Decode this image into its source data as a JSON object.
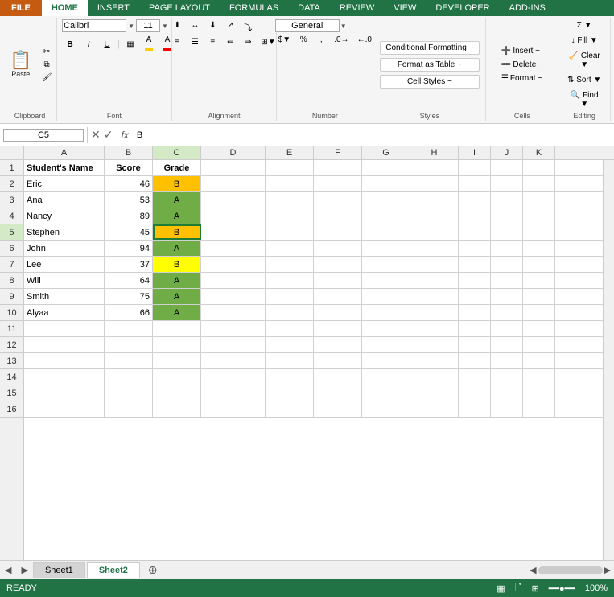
{
  "ribbon": {
    "file_label": "FILE",
    "tabs": [
      "HOME",
      "INSERT",
      "PAGE LAYOUT",
      "FORMULAS",
      "DATA",
      "REVIEW",
      "VIEW",
      "DEVELOPER",
      "ADD-INS"
    ],
    "active_tab": "HOME",
    "groups": {
      "clipboard": {
        "label": "Clipboard",
        "paste": "Paste"
      },
      "font": {
        "label": "Font",
        "font_name": "Calibri",
        "font_size": "11",
        "bold": "B",
        "italic": "I",
        "underline": "U",
        "increase_font": "A",
        "decrease_font": "A"
      },
      "alignment": {
        "label": "Alignment"
      },
      "number": {
        "label": "Number",
        "format": "General"
      },
      "styles": {
        "label": "Styles",
        "conditional_formatting": "Conditional Formatting ~",
        "format_as_table": "Format as Table ~",
        "cell_styles": "Cell Styles ~"
      },
      "cells": {
        "label": "Cells",
        "insert": "Insert ~",
        "delete": "Delete ~",
        "format": "Format ~"
      },
      "editing": {
        "label": "Editing"
      }
    }
  },
  "formula_bar": {
    "name_box": "C5",
    "formula_value": "B"
  },
  "spreadsheet": {
    "columns": [
      {
        "letter": "A",
        "width": 100
      },
      {
        "letter": "B",
        "width": 60
      },
      {
        "letter": "C",
        "width": 60
      },
      {
        "letter": "D",
        "width": 80
      },
      {
        "letter": "E",
        "width": 60
      },
      {
        "letter": "F",
        "width": 60
      },
      {
        "letter": "G",
        "width": 60
      },
      {
        "letter": "H",
        "width": 60
      },
      {
        "letter": "I",
        "width": 60
      },
      {
        "letter": "J",
        "width": 60
      },
      {
        "letter": "K",
        "width": 60
      }
    ],
    "rows": [
      {
        "num": 1,
        "cells": [
          {
            "val": "Student's Name",
            "bold": true,
            "bg": "",
            "color": "",
            "align": "left"
          },
          {
            "val": "Score",
            "bold": true,
            "bg": "",
            "color": "",
            "align": "center"
          },
          {
            "val": "Grade",
            "bold": true,
            "bg": "",
            "color": "",
            "align": "center"
          },
          {
            "val": "",
            "bg": "",
            "color": "",
            "align": "left"
          }
        ]
      },
      {
        "num": 2,
        "cells": [
          {
            "val": "Eric",
            "bold": false,
            "bg": "",
            "color": "",
            "align": "left"
          },
          {
            "val": "46",
            "bold": false,
            "bg": "",
            "color": "",
            "align": "right"
          },
          {
            "val": "B",
            "bold": false,
            "bg": "#ffc000",
            "color": "#000",
            "align": "center"
          },
          {
            "val": "",
            "bg": "",
            "color": "",
            "align": "left"
          }
        ]
      },
      {
        "num": 3,
        "cells": [
          {
            "val": "Ana",
            "bold": false,
            "bg": "",
            "color": "",
            "align": "left"
          },
          {
            "val": "53",
            "bold": false,
            "bg": "",
            "color": "",
            "align": "right"
          },
          {
            "val": "A",
            "bold": false,
            "bg": "#70ad47",
            "color": "#000",
            "align": "center"
          },
          {
            "val": "",
            "bg": "",
            "color": "",
            "align": "left"
          }
        ]
      },
      {
        "num": 4,
        "cells": [
          {
            "val": "Nancy",
            "bold": false,
            "bg": "",
            "color": "",
            "align": "left"
          },
          {
            "val": "89",
            "bold": false,
            "bg": "",
            "color": "",
            "align": "right"
          },
          {
            "val": "A",
            "bold": false,
            "bg": "#70ad47",
            "color": "#000",
            "align": "center"
          },
          {
            "val": "",
            "bg": "",
            "color": "",
            "align": "left"
          }
        ]
      },
      {
        "num": 5,
        "cells": [
          {
            "val": "Stephen",
            "bold": false,
            "bg": "",
            "color": "",
            "align": "left"
          },
          {
            "val": "45",
            "bold": false,
            "bg": "",
            "color": "",
            "align": "right"
          },
          {
            "val": "B",
            "bold": false,
            "bg": "#ffc000",
            "color": "#000",
            "align": "center",
            "selected": true
          },
          {
            "val": "",
            "bg": "",
            "color": "",
            "align": "left"
          }
        ]
      },
      {
        "num": 6,
        "cells": [
          {
            "val": "John",
            "bold": false,
            "bg": "",
            "color": "",
            "align": "left"
          },
          {
            "val": "94",
            "bold": false,
            "bg": "",
            "color": "",
            "align": "right"
          },
          {
            "val": "A",
            "bold": false,
            "bg": "#70ad47",
            "color": "#000",
            "align": "center"
          },
          {
            "val": "",
            "bg": "",
            "color": "",
            "align": "left"
          }
        ]
      },
      {
        "num": 7,
        "cells": [
          {
            "val": "Lee",
            "bold": false,
            "bg": "",
            "color": "",
            "align": "left"
          },
          {
            "val": "37",
            "bold": false,
            "bg": "",
            "color": "",
            "align": "right"
          },
          {
            "val": "B",
            "bold": false,
            "bg": "#ffff00",
            "color": "#000",
            "align": "center"
          },
          {
            "val": "",
            "bg": "",
            "color": "",
            "align": "left"
          }
        ]
      },
      {
        "num": 8,
        "cells": [
          {
            "val": "Will",
            "bold": false,
            "bg": "",
            "color": "",
            "align": "left"
          },
          {
            "val": "64",
            "bold": false,
            "bg": "",
            "color": "",
            "align": "right"
          },
          {
            "val": "A",
            "bold": false,
            "bg": "#70ad47",
            "color": "#000",
            "align": "center"
          },
          {
            "val": "",
            "bg": "",
            "color": "",
            "align": "left"
          }
        ]
      },
      {
        "num": 9,
        "cells": [
          {
            "val": "Smith",
            "bold": false,
            "bg": "",
            "color": "",
            "align": "left"
          },
          {
            "val": "75",
            "bold": false,
            "bg": "",
            "color": "",
            "align": "right"
          },
          {
            "val": "A",
            "bold": false,
            "bg": "#70ad47",
            "color": "#000",
            "align": "center"
          },
          {
            "val": "",
            "bg": "",
            "color": "",
            "align": "left"
          }
        ]
      },
      {
        "num": 10,
        "cells": [
          {
            "val": "Alyaa",
            "bold": false,
            "bg": "",
            "color": "",
            "align": "left"
          },
          {
            "val": "66",
            "bold": false,
            "bg": "",
            "color": "",
            "align": "right"
          },
          {
            "val": "A",
            "bold": false,
            "bg": "#70ad47",
            "color": "#000",
            "align": "center"
          },
          {
            "val": "",
            "bg": "",
            "color": "",
            "align": "left"
          }
        ]
      },
      {
        "num": 11,
        "cells": [
          {
            "val": "",
            "bg": "",
            "color": "",
            "align": "left"
          }
        ]
      },
      {
        "num": 12,
        "cells": [
          {
            "val": "",
            "bg": "",
            "color": "",
            "align": "left"
          }
        ]
      },
      {
        "num": 13,
        "cells": [
          {
            "val": "",
            "bg": "",
            "color": "",
            "align": "left"
          }
        ]
      },
      {
        "num": 14,
        "cells": [
          {
            "val": "",
            "bg": "",
            "color": "",
            "align": "left"
          }
        ]
      },
      {
        "num": 15,
        "cells": [
          {
            "val": "",
            "bg": "",
            "color": "",
            "align": "left"
          }
        ]
      },
      {
        "num": 16,
        "cells": [
          {
            "val": "",
            "bg": "",
            "color": "",
            "align": "left"
          }
        ]
      }
    ]
  },
  "sheet_tabs": {
    "tabs": [
      "Sheet1",
      "Sheet2"
    ],
    "active": "Sheet2",
    "add_label": "+"
  },
  "status_bar": {
    "left": "READY",
    "zoom_label": "100%"
  }
}
